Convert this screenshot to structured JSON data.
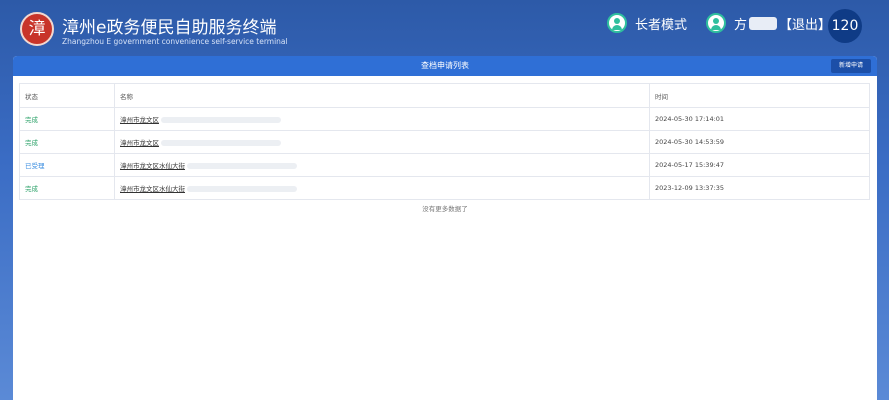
{
  "header": {
    "logo_text": "漳",
    "title": "漳州e政务便民自助服务终端",
    "subtitle": "Zhangzhou E government convenience self-service terminal",
    "elder_mode_label": "长者模式",
    "user_name": "方",
    "logout_label": "【退出】",
    "counter": "120"
  },
  "panel": {
    "title": "查档申请列表",
    "new_button": "新增申请",
    "columns": [
      "状态",
      "名称",
      "时间"
    ],
    "rows": [
      {
        "status": "完成",
        "name": "漳州市龙文区",
        "time": "2024-05-30 17:14:01"
      },
      {
        "status": "完成",
        "name": "漳州市龙文区",
        "time": "2024-05-30 14:53:59"
      },
      {
        "status": "已受理",
        "name": "漳州市龙文区水仙大街",
        "time": "2024-05-17 15:39:47"
      },
      {
        "status": "完成",
        "name": "漳州市龙文区水仙大街",
        "time": "2023-12-09 13:37:35"
      }
    ],
    "no_more": "没有更多数据了"
  },
  "colors": {
    "accent": "#2f6fd6",
    "done": "#2fa36b",
    "accepted": "#3a8de0"
  }
}
